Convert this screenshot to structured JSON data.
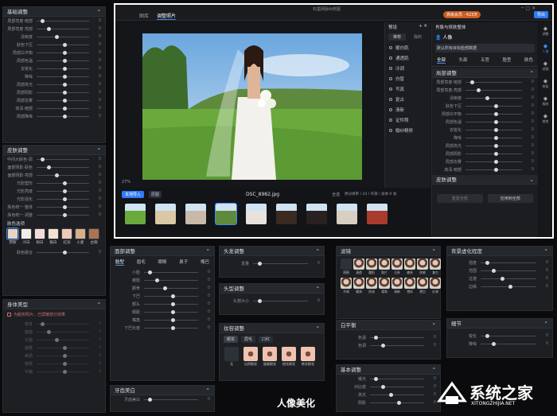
{
  "app": {
    "title": "石墨网版AI修图",
    "nav": [
      "图库",
      "调整照片"
    ],
    "member_badge": "高级会员 · 423天",
    "export_btn": "导出"
  },
  "left_top": {
    "title": "基础调整",
    "rows": [
      "局部亮度·暗部",
      "局部亮度·亮部",
      "清晰度",
      "肤色下压",
      "局部白平衡",
      "局部色温",
      "去锐化",
      "降噪",
      "局部高光",
      "局部阴影",
      "局部去雾",
      "高清·暗部",
      "局部降噪"
    ]
  },
  "left_mid": {
    "title": "皮肤调整",
    "rows": [
      "中间大肤色·调整",
      "面部阴影·肤色",
      "面部阴影·亮部",
      "光影塑形",
      "光影亮度",
      "光影强化",
      "肤色统一·整体",
      "肤色统一·调整"
    ],
    "swatch_title": "肤色选项",
    "swatches": [
      "原肤",
      "冷白",
      "粉白",
      "暖白",
      "红润",
      "小麦",
      "古铜"
    ],
    "intensity_label": "肤色融合"
  },
  "left_bot": {
    "title": "身体美型",
    "checkbox": "为服务照片，已屏蔽部分效果",
    "rows": [
      "瘦身",
      "瘦腿",
      "长腿",
      "瘦腰",
      "美颈",
      "瘦臂",
      "丰胸"
    ]
  },
  "image": {
    "filename": "DSC_8982.jpg",
    "zoom": "27%",
    "info": "原分辨率 / 24 / 外部 / 总体 0 张"
  },
  "toolbar": {
    "import_btn": "本地导入",
    "compare_btn": "原图",
    "count": "全选"
  },
  "presets": {
    "title": "预设",
    "tab1": "推荐",
    "tab2": "我的",
    "items": [
      "暖白肌",
      "通透肌",
      "冷调",
      "白皙",
      "写真",
      "复古",
      "清新",
      "证件照",
      "婚纱精修"
    ]
  },
  "right": {
    "title": "肖像与修肤整体",
    "sub": "人像",
    "dropdown": "默认所有目标脸部数据",
    "tabs": [
      "全部",
      "头部",
      "五官",
      "脸型",
      "肤色"
    ],
    "section": "局部调整",
    "rows": [
      "局部亮度·暗部",
      "局部亮度·亮部",
      "清晰度",
      "肤色下压",
      "局部白平衡",
      "局部色温",
      "去锐化",
      "降噪",
      "局部高光",
      "局部阴影",
      "局部去雾",
      "高清·暗部"
    ],
    "section2": "皮肤调整",
    "reset": "重置全部",
    "apply": "应用到全部"
  },
  "side_icons": [
    "调整",
    "人像",
    "滤镜",
    "修复",
    "服装",
    "裁剪"
  ],
  "p_face": {
    "title": "面部调整",
    "tabs": [
      "脸型",
      "眉毛",
      "眼睛",
      "鼻子",
      "嘴巴"
    ],
    "rows": [
      "小脸",
      "瘦脸",
      "颧骨",
      "下巴",
      "额头",
      "眼距",
      "嘴角",
      "下巴长度"
    ]
  },
  "p_hair": {
    "title": "头发调整",
    "rows": [
      "发量"
    ]
  },
  "p_shape": {
    "title": "头型调整",
    "rows": [
      "头部大小"
    ]
  },
  "p_makeup": {
    "title": "妆容调整",
    "tabs": [
      "眼妆",
      "眉毛",
      "口红"
    ],
    "items": [
      "无",
      "自然眼妆",
      "烟熏眼妆",
      "桃花眼妆",
      "韩系眼妆"
    ]
  },
  "p_misc": {
    "title": "牙齿美白",
    "rows": [
      "牙齿美白"
    ]
  },
  "p_filter": {
    "title": "滤镜",
    "names": [
      "原图",
      "清透",
      "暖阳",
      "胶片",
      "日系",
      "森系",
      "质感",
      "复古",
      "冷调",
      "暖调",
      "奶油",
      "柔和",
      "清新",
      "港风",
      "黑白",
      "红调"
    ]
  },
  "p_bg": {
    "title": "背景虚化程度",
    "rows": [
      "强度",
      "范围",
      "过渡",
      "边缘"
    ]
  },
  "p_wb": {
    "title": "白平衡",
    "rows": [
      "色温",
      "色调"
    ]
  },
  "p_detail": {
    "title": "细节",
    "rows": [
      "锐化",
      "降噪"
    ]
  },
  "p_basic": {
    "title": "基本调整",
    "rows": [
      "曝光",
      "对比度",
      "高光",
      "阴影"
    ]
  },
  "caption": "人像美化",
  "watermark": {
    "main": "系统之家",
    "sub": "XITONGZHIJIA.NET"
  }
}
